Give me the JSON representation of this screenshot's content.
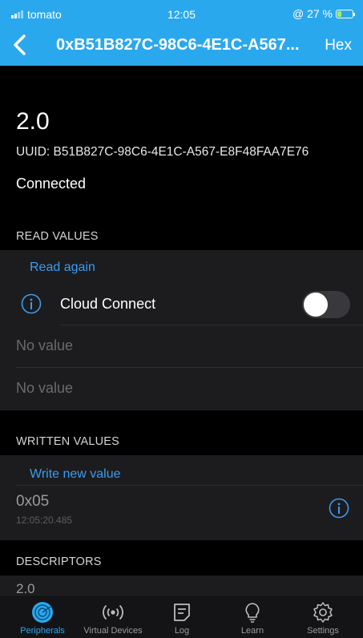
{
  "status_bar": {
    "carrier": "tomato",
    "time": "12:05",
    "battery_text": "@ 27 %",
    "battery_level": 0.27
  },
  "nav": {
    "title": "0xB51B827C-98C6-4E1C-A567...",
    "hex_button": "Hex"
  },
  "characteristic": {
    "value": "2.0",
    "uuid": "UUID: B51B827C-98C6-4E1C-A567-E8F48FAA7E76",
    "state": "Connected"
  },
  "read_values": {
    "header": "READ VALUES",
    "read_again": "Read again",
    "cloud_connect_label": "Cloud Connect",
    "cloud_connect_on": false,
    "values": [
      "No value",
      "No value"
    ]
  },
  "written_values": {
    "header": "WRITTEN VALUES",
    "write_new": "Write new value",
    "entry_value": "0x05",
    "entry_time": "12:05:20.485"
  },
  "descriptors": {
    "header": "DESCRIPTORS",
    "first_value": "2.0"
  },
  "tabs": [
    {
      "label": "Peripherals",
      "icon": "radar-icon",
      "active": true
    },
    {
      "label": "Virtual Devices",
      "icon": "broadcast-icon",
      "active": false
    },
    {
      "label": "Log",
      "icon": "log-icon",
      "active": false
    },
    {
      "label": "Learn",
      "icon": "lightbulb-icon",
      "active": false
    },
    {
      "label": "Settings",
      "icon": "gear-icon",
      "active": false
    }
  ],
  "colors": {
    "accent": "#2aa8ee",
    "link": "#3b9bf0",
    "background": "#000000",
    "cell": "#1c1c1e"
  }
}
